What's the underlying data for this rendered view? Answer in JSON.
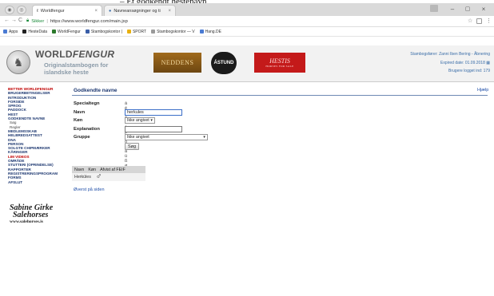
{
  "caption": "– Et godkendt hestenavn",
  "browser": {
    "tabs": [
      {
        "label": "Worldfengur",
        "close": "×"
      },
      {
        "label": "Navneansøgninger og ti",
        "close": "×"
      }
    ],
    "window_controls": {
      "minimize": "–",
      "maximize": "▢",
      "close": "×"
    },
    "address": {
      "secure_label": "Sikker",
      "url": "https://www.worldfengur.com/main.jsp"
    },
    "bookmarks": [
      "Apps",
      "HesteData",
      "WorldFengur",
      "Stambogskontor |",
      "SPORT",
      "Stambogskontor — V",
      "Hang.DE"
    ],
    "bookmark_colors": [
      "#4a7bd3",
      "#222222",
      "#2c7a2c",
      "#3a5ea8",
      "#e8b010",
      "#9a9a9a",
      "#4a7bd3"
    ]
  },
  "header": {
    "logo_title_a": "WORLD",
    "logo_title_b": "FENGUR",
    "logo_sub_1": "Originalstambogen for",
    "logo_sub_2": "islandske heste",
    "ads": {
      "neddens": "NEDDENS",
      "astund": "ÁSTUND",
      "hestis": "HESTIS",
      "hestis_sub": "HORSES FOR SALE"
    },
    "right": {
      "line1": "Stambogsfører: Zanni Iben Bering - Åbnering",
      "line2": "Expired date: 01.09.2018",
      "line3": "Brugere logget ind: 179"
    }
  },
  "leftnav": [
    {
      "label": "BETTER WORLDFENGUR",
      "style": "red"
    },
    {
      "label": "BRUGERBETINGELSER",
      "style": "normal"
    },
    {
      "label": "INTRODUKTION",
      "style": "normal"
    },
    {
      "label": "FORSIDE",
      "style": "normal"
    },
    {
      "label": "SPROG",
      "style": "normal"
    },
    {
      "label": "PADDOCK",
      "style": "normal"
    },
    {
      "label": "HEST",
      "style": "normal"
    },
    {
      "label": "GODKENDTE NAVNE",
      "style": "normal"
    },
    {
      "label": "Søg",
      "style": "sub"
    },
    {
      "label": "Regler",
      "style": "sub"
    },
    {
      "label": "MEDLEMSSKAB",
      "style": "normal"
    },
    {
      "label": "HELBREDSATTEST",
      "style": "normal"
    },
    {
      "label": "DNA",
      "style": "normal"
    },
    {
      "label": "PERSON",
      "style": "normal"
    },
    {
      "label": "SOLGTE CHIPMÆRKER",
      "style": "normal"
    },
    {
      "label": "KÅRINGER",
      "style": "normal"
    },
    {
      "label": "LIM VIDEOS",
      "style": "red"
    },
    {
      "label": "OMRÅDE",
      "style": "normal"
    },
    {
      "label": "STUTTERI (OPRINDELSE)",
      "style": "normal"
    },
    {
      "label": "RAPPORTER",
      "style": "normal"
    },
    {
      "label": "REGISTRERINGSPROGRAM",
      "style": "normal"
    },
    {
      "label": "FORMS",
      "style": "normal"
    },
    {
      "label": "AFSLUT",
      "style": "normal"
    }
  ],
  "salehorses": {
    "line1": "Sabine Girke",
    "line2": "Salehorses",
    "url": "www.salehorses.is"
  },
  "main": {
    "title": "Godkendte navne",
    "help": "Hjælp",
    "special_label": "Specialtegn",
    "special_chars": "á é í ó ú ý þ æ ö ä å ü ß ø",
    "name_label": "Navn",
    "name_value": "herkules",
    "gender_label": "Køn",
    "gender_value": "Ikke angivet",
    "explanation_label": "Explanation",
    "explanation_value": "",
    "group_label": "Gruppe",
    "group_value": "Ikke angivet",
    "search_button": "Søg",
    "results_headers": [
      "Navn",
      "Køn",
      "Afvist af FEIF"
    ],
    "results": [
      {
        "name": "Herkúles",
        "gender_symbol": "♂",
        "rejected": ""
      }
    ],
    "top_link": "Øverst på siden"
  }
}
